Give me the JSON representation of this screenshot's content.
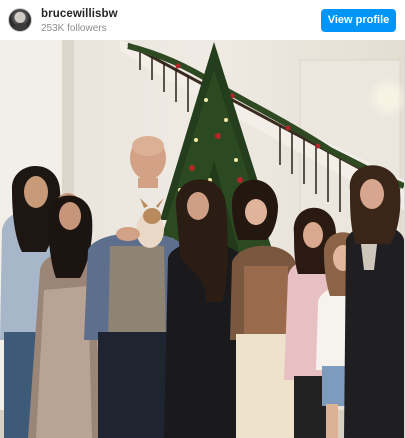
{
  "post": {
    "username": "brucewillisbw",
    "followers": "253K followers",
    "view_profile_label": "View profile"
  },
  "photo": {
    "icons": [
      "avatar",
      "christmas-tree"
    ]
  },
  "colors": {
    "accent": "#0095f6",
    "username": "#262626",
    "muted": "#8e8e8e"
  }
}
